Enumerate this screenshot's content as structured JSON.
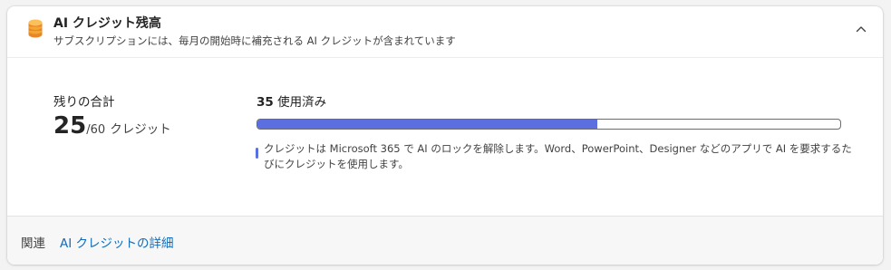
{
  "header": {
    "icon": "stacked-coins-icon",
    "title": "AI クレジット残高",
    "subtitle": "サブスクリプションには、毎月の開始時に補充される AI クレジットが含まれています",
    "collapse_icon": "chevron-up-icon"
  },
  "summary": {
    "label": "残りの合計",
    "remaining": "25",
    "total": "/60",
    "unit": "クレジット"
  },
  "usage": {
    "used_number": "35",
    "used_suffix": "使用済み",
    "progress_fraction": 0.583,
    "note": "クレジットは Microsoft 365 で AI のロックを解除します。Word、PowerPoint、Designer などのアプリで AI を要求するたびにクレジットを使用します。"
  },
  "footer": {
    "label": "関連",
    "link": "AI クレジットの詳細"
  },
  "colors": {
    "accent": "#5b6fe0",
    "link": "#0f6cbd",
    "coin": "#f4a534"
  }
}
